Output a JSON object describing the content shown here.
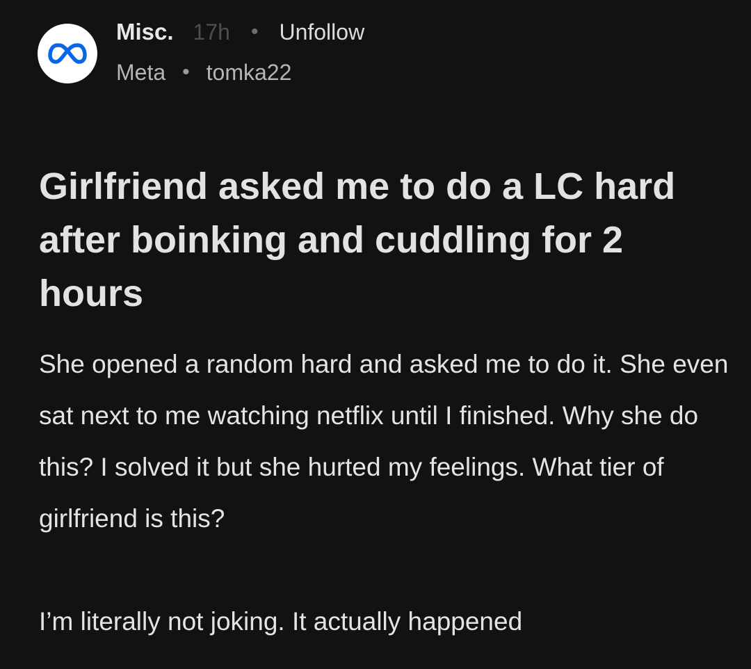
{
  "post": {
    "community": {
      "name": "Misc.",
      "icon": "meta-logo-icon",
      "flair": "Meta"
    },
    "timestamp": "17h",
    "separator": "•",
    "unfollow_label": "Unfollow",
    "author": "tomka22",
    "title": "Girlfriend asked me to do a LC hard after boinking and cuddling for 2 hours",
    "body": [
      "She opened a random hard and asked me to do it. She even sat next to me watching netflix until I finished. Why she do this? I solved it but she hurted my feelings. What tier of girlfriend is this?",
      "I’m literally not joking. It actually happened"
    ]
  },
  "colors": {
    "background": "#121212",
    "logo_blue": "#0a66e8",
    "avatar_bg": "#ffffff"
  }
}
